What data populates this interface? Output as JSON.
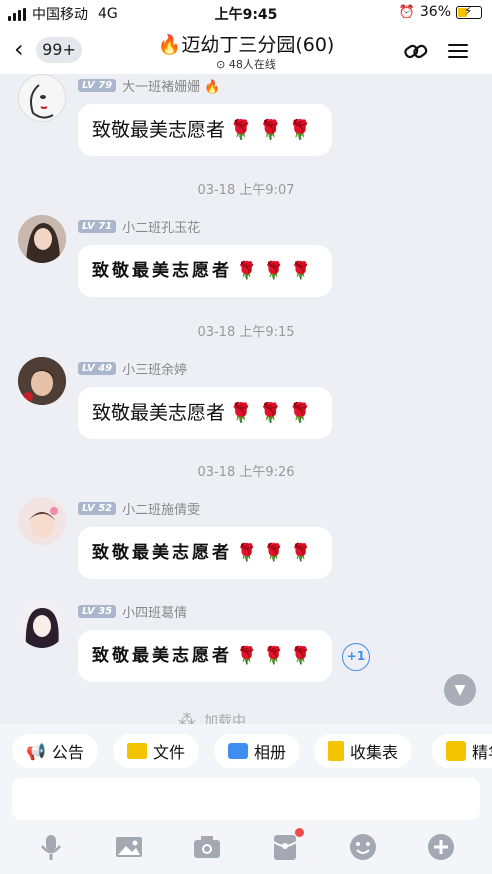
{
  "status_bar": {
    "carrier": "中国移动",
    "network": "4G",
    "time": "上午9:45",
    "battery": "36%"
  },
  "header": {
    "back_count": "99+",
    "title": "🔥迈幼丁三分园(60)",
    "online": "48人在线"
  },
  "messages": [
    {
      "level": "LV 79",
      "sender": "大一班褚姗姗 🔥",
      "text": "致敬最美志愿者",
      "roses": "🌹🌹🌹",
      "fancy": false
    },
    {
      "level": "LV 71",
      "sender": "小二班孔玉花",
      "text": "致敬最美志愿者",
      "roses": "🌹🌹🌹",
      "fancy": true
    },
    {
      "level": "LV 49",
      "sender": "小三班余婷",
      "text": "致敬最美志愿者",
      "roses": "🌹🌹🌹",
      "fancy": false
    },
    {
      "level": "LV 52",
      "sender": "小二班施倩雯",
      "text": "致敬最美志愿者",
      "roses": "🌹🌹🌹",
      "fancy": true
    },
    {
      "level": "LV 35",
      "sender": "小四班葛倩",
      "text": "致敬最美志愿者",
      "roses": "🌹🌹🌹",
      "fancy": true
    }
  ],
  "timestamps": [
    "03-18 上午9:07",
    "03-18 上午9:15",
    "03-18 上午9:26"
  ],
  "plus_one": "+1",
  "loading_text": "加载中",
  "quick_actions": [
    {
      "label": "公告",
      "icon": "megaphone-icon"
    },
    {
      "label": "文件",
      "icon": "folder-icon"
    },
    {
      "label": "相册",
      "icon": "album-icon"
    },
    {
      "label": "收集表",
      "icon": "form-icon"
    },
    {
      "label": "精华",
      "icon": "essence-icon"
    }
  ],
  "input": {
    "placeholder": ""
  },
  "colors": {
    "accent": "#3d8ef0",
    "rose": "#c81e2a",
    "level_badge": "#aab6cc"
  }
}
